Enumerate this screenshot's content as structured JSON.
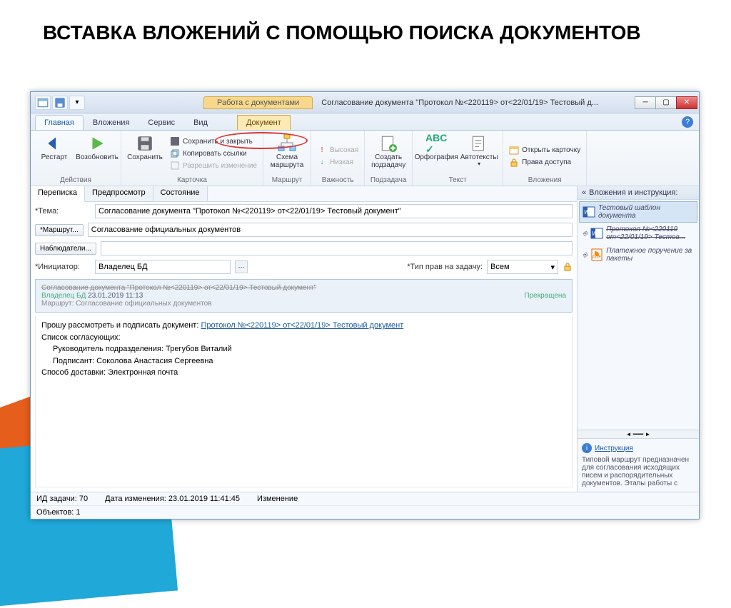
{
  "slide": {
    "title": "ВСТАВКА ВЛОЖЕНИЙ С ПОМОЩЬЮ ПОИСКА ДОКУМЕНТОВ"
  },
  "window": {
    "context_tab": "Работа с документами",
    "title": "Согласование документа \"Протокол №<220119> от<22/01/19> Тестовый д..."
  },
  "ribbon": {
    "tabs": [
      "Главная",
      "Вложения",
      "Сервис",
      "Вид"
    ],
    "context_tab": "Документ",
    "groups": {
      "actions": {
        "restart": "Рестарт",
        "resume": "Возобновить",
        "label": "Действия"
      },
      "card": {
        "save": "Сохранить",
        "save_close": "Сохранить и закрыть",
        "copy_link": "Копировать ссылки",
        "allow_edit": "Разрешить изменение",
        "label": "Карточка"
      },
      "route": {
        "scheme": "Схема маршрута",
        "label": "Маршрут"
      },
      "importance": {
        "high": "Высокая",
        "low": "Низкая",
        "label": "Важность"
      },
      "subtask": {
        "create": "Создать подзадачу",
        "label": "Подзадача"
      },
      "text": {
        "spell": "Орфография",
        "autotext": "Автотексты",
        "label": "Текст"
      },
      "attach": {
        "open_card": "Открыть карточку",
        "rights": "Права доступа",
        "label": "Вложения"
      }
    }
  },
  "subtabs": [
    "Переписка",
    "Предпросмотр",
    "Состояние"
  ],
  "form": {
    "subject_label": "*Тема:",
    "subject": "Согласование документа \"Протокол №<220119> от<22/01/19> Тестовый документ\"",
    "desc": "Согласование официальных документов",
    "route_btn": "*Маршрут...",
    "observers_btn": "Наблюдатели...",
    "initiator_label": "*Инициатор:",
    "initiator": "Владелец БД",
    "rights_label": "*Тип прав на задачу:",
    "rights": "Всем"
  },
  "message": {
    "title": "Согласование документа \"Протокол №<220119> от<22/01/19> Тестовый документ\"",
    "author": "Владелец БД",
    "date": "23.01.2019 11:13",
    "status": "Прекращена",
    "route_label": "Маршрут:",
    "route": "Согласование официальных документов",
    "body_intro": "Прошу рассмотреть и подписать документ:",
    "body_link": "Протокол №<220119> от<22/01/19> Тестовый документ",
    "signers_head": "Список согласующих:",
    "signer1_role": "Руководитель подразделения:",
    "signer1_name": "Трегубов Виталий",
    "signer2_role": "Подписант:",
    "signer2_name": "Соколова Анастасия Сергеевна",
    "delivery_label": "Способ доставки:",
    "delivery": "Электронная почта"
  },
  "side": {
    "header": "Вложения и инструкция:",
    "items": [
      {
        "name": "Тестовый шаблон документа",
        "type": "word"
      },
      {
        "name": "Протокол №<220119 от<22/01/19> Тестов...",
        "type": "word",
        "strike": true
      },
      {
        "name": "Платежное поручение за пакеты",
        "type": "pdf"
      }
    ],
    "instr_head": "Инструкция",
    "instr_body": "Типовой маршрут предназначен для согласования исходящих писем и распорядительных документов. Этапы работы с"
  },
  "status": {
    "task_id_label": "ИД задачи:",
    "task_id": "70",
    "modified_label": "Дата изменения:",
    "modified": "23.01.2019 11:41:45",
    "change": "Изменение",
    "objects_label": "Объектов:",
    "objects": "1"
  }
}
